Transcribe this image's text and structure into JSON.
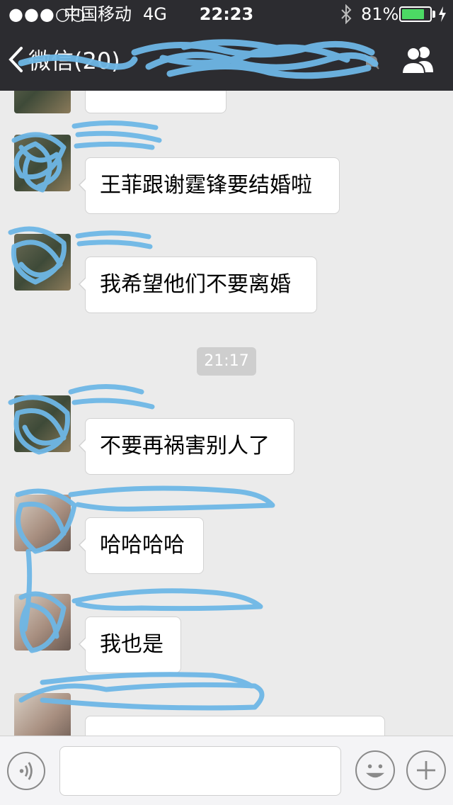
{
  "status_bar": {
    "signal": "●●●○○",
    "carrier": "中国移动",
    "network": "4G",
    "time": "22:23",
    "battery_percent": "81%",
    "battery_level": 0.81,
    "icons": [
      "bluetooth-icon",
      "battery-icon",
      "charging-bolt-icon"
    ]
  },
  "nav": {
    "back_label": "微信(20)",
    "chat_title": "",
    "icons": [
      "back-chevron-icon",
      "mute-icon",
      "group-members-icon"
    ]
  },
  "messages": [
    {
      "sender": "",
      "text": ""
    },
    {
      "sender": "",
      "text": "王菲跟谢霆锋要结婚啦"
    },
    {
      "sender": "",
      "text": "我希望他们不要离婚"
    },
    {
      "sender": "",
      "text": "不要再祸害别人了"
    },
    {
      "sender": "",
      "text": "哈哈哈哈"
    },
    {
      "sender": "",
      "text": "我也是"
    },
    {
      "sender": "",
      "text": ""
    }
  ],
  "timestamp": "21:17",
  "input_bar": {
    "placeholder": "",
    "icons": [
      "voice-icon",
      "emoji-icon",
      "plus-icon"
    ]
  },
  "colors": {
    "top_bar": "#2c2c30",
    "chat_background": "#ebebeb",
    "bubble": "#ffffff",
    "battery_fill": "#4cd964",
    "scribble": "#6eb7e6"
  }
}
